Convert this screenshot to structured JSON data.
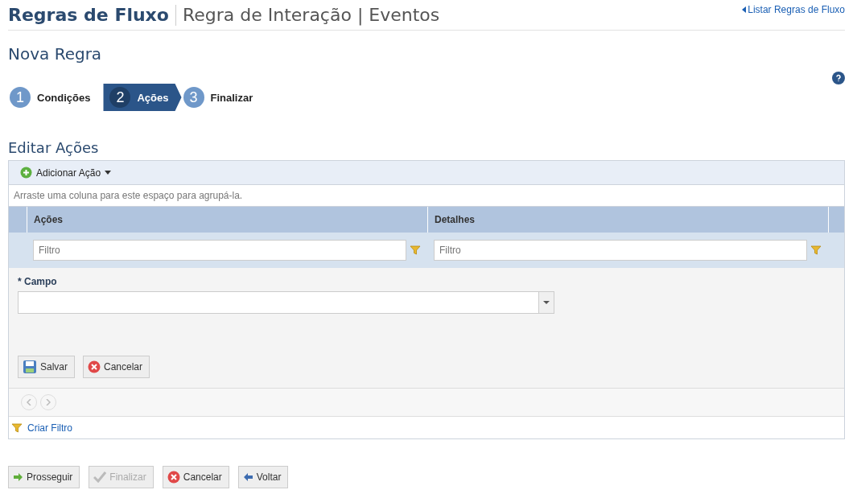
{
  "header": {
    "title": "Regras de Fluxo",
    "subtitle": "Regra de Interação | Eventos",
    "link": "Listar Regras de Fluxo"
  },
  "page_title": "Nova Regra",
  "steps": [
    {
      "number": "1",
      "label": "Condições",
      "selected": false
    },
    {
      "number": "2",
      "label": "Ações",
      "selected": true
    },
    {
      "number": "3",
      "label": "Finalizar",
      "selected": false
    }
  ],
  "section_title": "Editar Ações",
  "grid": {
    "toolbar_button": "Adicionar Ação",
    "group_hint": "Arraste uma coluna para este espaço para agrupá-la.",
    "columns": [
      {
        "label": "Ações",
        "filter_placeholder": "Filtro"
      },
      {
        "label": "Detalhes",
        "filter_placeholder": "Filtro"
      }
    ],
    "edit_form": {
      "field_label": "* Campo",
      "buttons": [
        {
          "kind": "save",
          "label": "Salvar"
        },
        {
          "kind": "cancel",
          "label": "Cancelar"
        }
      ]
    },
    "footer_link": "Criar Filtro"
  },
  "actions": [
    {
      "kind": "next",
      "label": "Prosseguir",
      "disabled": false
    },
    {
      "kind": "finish",
      "label": "Finalizar",
      "disabled": true
    },
    {
      "kind": "cancel",
      "label": "Cancelar",
      "disabled": false
    },
    {
      "kind": "back",
      "label": "Voltar",
      "disabled": false
    }
  ]
}
